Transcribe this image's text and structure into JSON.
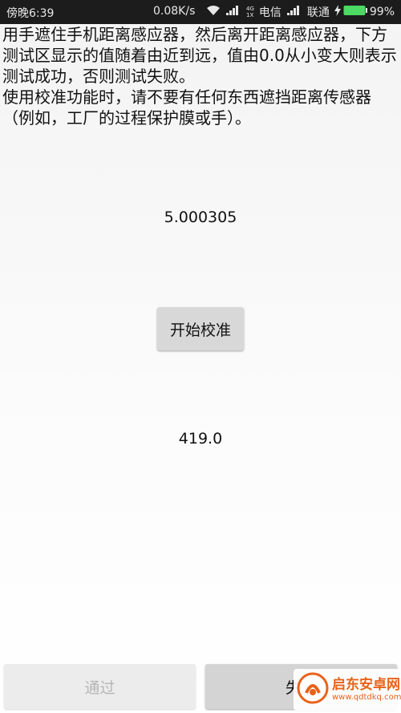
{
  "status_bar": {
    "time": "傍晚6:39",
    "net_speed": "0.08K/s",
    "carrier1": "电信",
    "carrier2": "联通",
    "battery": "99%",
    "net_type_top": "4G",
    "net_type_bottom": "1X",
    "icons": [
      "wifi-icon",
      "signal-icon",
      "charging-icon",
      "battery-icon"
    ]
  },
  "instructions": {
    "line1": "用手遮住手机距离感应器，然后离开距离感应器，下方测试区显示的值随着由近到远，值由0.0从小变大则表示测试成功，否则测试失败。",
    "line2": "使用校准功能时，请不要有任何东西遮挡距离传感器（例如，工厂的过程保护膜或手）。"
  },
  "proximity_value": "5.000305",
  "calibrate_button": "开始校准",
  "raw_value": "419.0",
  "buttons": {
    "pass": "通过",
    "fail": "失"
  },
  "watermark": {
    "name": "启东安卓网",
    "url": "www.qdtdkq.com"
  },
  "colors": {
    "status_bar_bg": "#1c1c1c",
    "battery_green": "#4cd964",
    "watermark_orange": "#e8631a"
  }
}
